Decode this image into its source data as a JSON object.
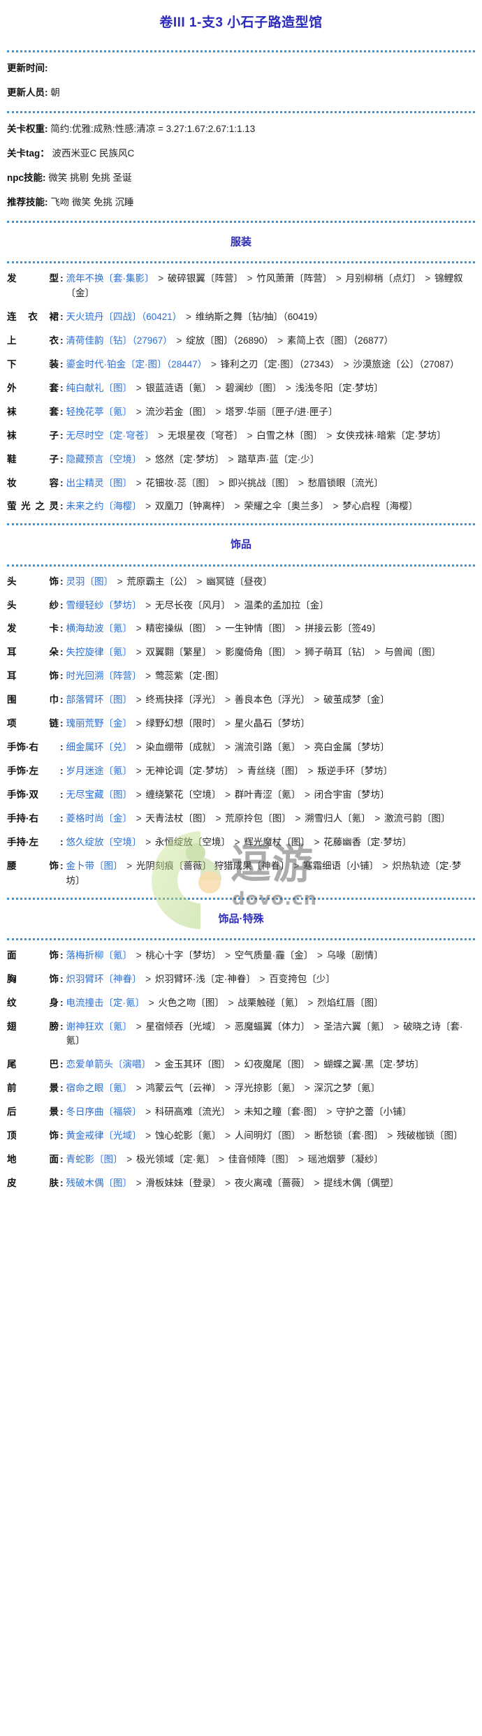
{
  "document": {
    "title": "卷III 1-支3 小石子路造型馆"
  },
  "meta": {
    "rows": [
      {
        "key": "更新时间:",
        "value": ""
      },
      {
        "key": "更新人员:",
        "value": "朝"
      }
    ],
    "rows2": [
      {
        "key": "关卡权重:",
        "value": "简约:优雅:成熟:性感:清凉 = 3.27:1.67:2.67:1:1.13"
      },
      {
        "key": "关卡tag：",
        "value": "波西米亚C 民族风C"
      },
      {
        "key": "npc技能:",
        "value": "微笑 挑剔 免挑 圣诞"
      },
      {
        "key": "推荐技能:",
        "value": "飞吻 微笑 免挑 沉睡"
      }
    ]
  },
  "watermark": {
    "text": "逗游",
    "subtext": "dovo.cn"
  },
  "sections": [
    {
      "name": "服装",
      "rows": [
        {
          "slot": "发　　型",
          "items": [
            "流年不换〔套·集影〕",
            "破碎银翼〔阵营〕",
            "竹风萧萧〔阵营〕",
            "月别柳梢〔点灯〕",
            "锦鲤叙〔金〕"
          ]
        },
        {
          "slot": "连 衣 裙",
          "items": [
            "天火琉丹〔四战〕（60421）",
            "维纳斯之舞〔钻/抽〕（60419）"
          ]
        },
        {
          "slot": "上　　衣",
          "items": [
            "清荷佳韵〔钻〕（27967）",
            "绽放〔图〕（26890）",
            "素简上衣〔图〕（26877）"
          ]
        },
        {
          "slot": "下　　装",
          "items": [
            "鎏金时代·铂金〔定·图〕（28447）",
            "锋利之刃〔定·图〕（27343）",
            "沙漠旅途〔公〕（27087）"
          ]
        },
        {
          "slot": "外　　套",
          "items": [
            "纯白献礼〔图〕",
            "银蓝涟语〔氪〕",
            "碧澜纱〔图〕",
            "浅浅冬阳〔定·梦坊〕"
          ]
        },
        {
          "slot": "袜　　套",
          "items": [
            "轻挽花葶〔氪〕",
            "流沙若金〔图〕",
            "塔罗·华丽〔匣子/进·匣子〕"
          ]
        },
        {
          "slot": "袜　　子",
          "items": [
            "无尽时空〔定·穹苍〕",
            "无垠星夜〔穹苍〕",
            "白雪之林〔图〕",
            "女侠戎袜·暗紫〔定·梦坊〕"
          ]
        },
        {
          "slot": "鞋　　子",
          "items": [
            "隐藏预言〔空境〕",
            "悠然〔定·梦坊〕",
            "踏草声·蓝〔定·少〕"
          ]
        },
        {
          "slot": "妆　　容",
          "items": [
            "出尘精灵〔图〕",
            "花钿妆·蕊〔图〕",
            "即兴挑战〔图〕",
            "愁眉锁眼〔流光〕"
          ]
        },
        {
          "slot": "萤光之灵",
          "items": [
            "未来之约〔海樱〕",
            "双凰刀〔钟离梓〕",
            "荣耀之伞〔奥兰多〕",
            "梦心启程〔海樱〕"
          ]
        }
      ]
    },
    {
      "name": "饰品",
      "rows": [
        {
          "slot": "头　　饰",
          "items": [
            "灵羽〔图〕",
            "荒原霸主〔公〕",
            "幽冥链〔昼夜〕"
          ]
        },
        {
          "slot": "头　　纱",
          "items": [
            "雪缦轻纱〔梦坊〕",
            "无尽长夜〔风月〕",
            "温柔的孟加拉〔金〕"
          ]
        },
        {
          "slot": "发　　卡",
          "items": [
            "横海劫波〔氪〕",
            "精密操纵〔图〕",
            "一生钟情〔图〕",
            "拼接云影〔签49〕"
          ]
        },
        {
          "slot": "耳　　朵",
          "items": [
            "失控旋律〔氪〕",
            "双翼翾〔繁星〕",
            "影魔倚角〔图〕",
            "狮子萌耳〔钻〕",
            "与兽闻〔图〕"
          ]
        },
        {
          "slot": "耳　　饰",
          "items": [
            "时光回溯〔阵营〕",
            "莺蕊紫〔定·图〕"
          ]
        },
        {
          "slot": "围　　巾",
          "items": [
            "部落臂环〔图〕",
            "终焉抉择〔浮光〕",
            "善良本色〔浮光〕",
            "破茧成梦〔金〕"
          ]
        },
        {
          "slot": "项　　链",
          "items": [
            "瑰丽荒野〔金〕",
            "绿野幻想〔限时〕",
            "星火晶石〔梦坊〕"
          ]
        },
        {
          "slot": "手饰·右",
          "items": [
            "细金属环〔兑〕",
            "染血绷带〔成就〕",
            "湍流引路〔氪〕",
            "亮白金属〔梦坊〕"
          ]
        },
        {
          "slot": "手饰·左",
          "items": [
            "岁月迷途〔氪〕",
            "无神论调〔定·梦坊〕",
            "青丝绕〔图〕",
            "叛逆手环〔梦坊〕"
          ]
        },
        {
          "slot": "手饰·双",
          "items": [
            "无尽宝藏〔图〕",
            "缠绕繁花〔空境〕",
            "群叶青涩〔氪〕",
            "闭合宇宙〔梦坊〕"
          ]
        },
        {
          "slot": "手持·右",
          "items": [
            "菱格时尚〔金〕",
            "天青法杖〔图〕",
            "荒原拎包〔图〕",
            "溯雪归人〔氪〕",
            "激流弓韵〔图〕"
          ]
        },
        {
          "slot": "手持·左",
          "items": [
            "悠久绽放〔空境〕",
            "永恒绽放〔空境〕",
            "辉光魔杖〔图〕",
            "花藤幽香〔定·梦坊〕"
          ]
        },
        {
          "slot": "腰　　饰",
          "items": [
            "金卜带〔图〕",
            "光阴刻痕〔蔷薇〕 狩猎成果〔神眷〕",
            "寒霜细语〔小铺〕",
            "炽热轨迹〔定·梦坊〕"
          ]
        }
      ]
    },
    {
      "name": "饰品·特殊",
      "rows": [
        {
          "slot": "面　　饰",
          "items": [
            "落梅折柳〔氪〕",
            "桃心十字〔梦坊〕",
            "空气质量·霾〔金〕",
            "乌喙〔剧情〕"
          ]
        },
        {
          "slot": "胸　　饰",
          "items": [
            "炽羽臂环〔神眷〕",
            "炽羽臂环·浅〔定·神眷〕",
            "百变挎包〔少〕"
          ]
        },
        {
          "slot": "纹　　身",
          "items": [
            "电流撞击〔定·氪〕",
            "火色之吻〔图〕",
            "战栗触碰〔氪〕",
            "烈焰红唇〔图〕"
          ]
        },
        {
          "slot": "翅　　膀",
          "items": [
            "谢神狂欢〔氪〕",
            "星宿倾吞〔光域〕",
            "恶魔蝠翼〔体力〕",
            "圣洁六翼〔氪〕",
            "破晓之诗〔套·氪〕"
          ]
        },
        {
          "slot": "尾　　巴",
          "items": [
            "恋爱单箭头〔演唱〕",
            "金玉其环〔图〕",
            "幻夜魔尾〔图〕",
            "蝴蝶之翼·黑〔定·梦坊〕"
          ]
        },
        {
          "slot": "前　　景",
          "items": [
            "宿命之眼〔氪〕",
            "鸿蒙云气〔云禅〕",
            "浮光掠影〔氪〕",
            "深沉之梦〔氪〕"
          ]
        },
        {
          "slot": "后　　景",
          "items": [
            "冬日序曲〔福袋〕",
            "科研高难〔流光〕",
            "未知之瞳〔套·图〕",
            "守护之蕾〔小铺〕"
          ]
        },
        {
          "slot": "顶　　饰",
          "items": [
            "黄金戒律〔光域〕",
            "蚀心蛇影〔氪〕",
            "人间明灯〔图〕",
            "断愁锁〔套·图〕",
            "残破枷锁〔图〕"
          ]
        },
        {
          "slot": "地　　面",
          "items": [
            "青蛇影〔图〕",
            "极光领域〔定·氪〕",
            "佳音倾降〔图〕",
            "瑶池烟萝〔凝纱〕"
          ]
        },
        {
          "slot": "皮　　肤",
          "items": [
            "残破木偶〔图〕",
            "滑板妹妹〔登录〕",
            "夜火离魂〔蔷薇〕",
            "提线木偶〔偶塑〕"
          ]
        }
      ]
    }
  ]
}
